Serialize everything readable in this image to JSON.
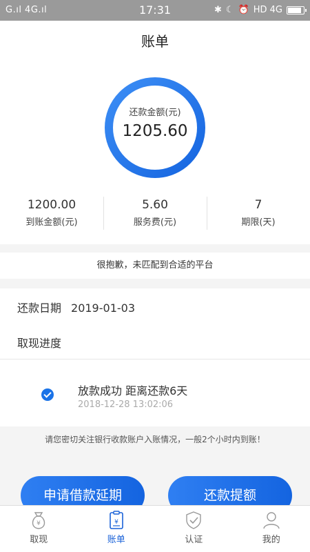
{
  "status_bar": {
    "left": "G.ıl 4G.ıl",
    "time": "17:31",
    "right": "HD 4G"
  },
  "header": {
    "title": "账单"
  },
  "summary": {
    "ring_label": "还款金额(元)",
    "ring_value": "1205.60",
    "ring_color": "#1a73e8",
    "stats": [
      {
        "value": "1200.00",
        "label": "到账金额(元)"
      },
      {
        "value": "5.60",
        "label": "服务费(元)"
      },
      {
        "value": "7",
        "label": "期限(天)"
      }
    ]
  },
  "notice": "很抱歉，未匹配到合适的平台",
  "info": {
    "repay_date_label": "还款日期",
    "repay_date_value": "2019-01-03",
    "progress_label": "取现进度"
  },
  "progress": {
    "title": "放款成功  距离还款6天",
    "time": "2018-12-28 13:02:06"
  },
  "tip": "请您密切关注银行收款账户入账情况，一般2个小时内到账！",
  "buttons": {
    "extend": "申请借款延期",
    "repay": "还款提额"
  },
  "tabs": [
    {
      "label": "取现",
      "icon": "money-bag-icon",
      "active": false
    },
    {
      "label": "账单",
      "icon": "bill-icon",
      "active": true
    },
    {
      "label": "认证",
      "icon": "shield-check-icon",
      "active": false
    },
    {
      "label": "我的",
      "icon": "user-icon",
      "active": false
    }
  ]
}
